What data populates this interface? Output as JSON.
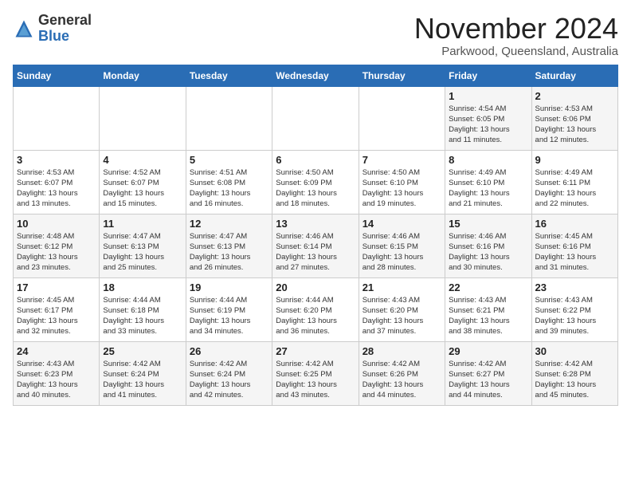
{
  "header": {
    "logo_general": "General",
    "logo_blue": "Blue",
    "month_title": "November 2024",
    "subtitle": "Parkwood, Queensland, Australia"
  },
  "days_of_week": [
    "Sunday",
    "Monday",
    "Tuesday",
    "Wednesday",
    "Thursday",
    "Friday",
    "Saturday"
  ],
  "weeks": [
    [
      {
        "day": "",
        "info": ""
      },
      {
        "day": "",
        "info": ""
      },
      {
        "day": "",
        "info": ""
      },
      {
        "day": "",
        "info": ""
      },
      {
        "day": "",
        "info": ""
      },
      {
        "day": "1",
        "info": "Sunrise: 4:54 AM\nSunset: 6:05 PM\nDaylight: 13 hours\nand 11 minutes."
      },
      {
        "day": "2",
        "info": "Sunrise: 4:53 AM\nSunset: 6:06 PM\nDaylight: 13 hours\nand 12 minutes."
      }
    ],
    [
      {
        "day": "3",
        "info": "Sunrise: 4:53 AM\nSunset: 6:07 PM\nDaylight: 13 hours\nand 13 minutes."
      },
      {
        "day": "4",
        "info": "Sunrise: 4:52 AM\nSunset: 6:07 PM\nDaylight: 13 hours\nand 15 minutes."
      },
      {
        "day": "5",
        "info": "Sunrise: 4:51 AM\nSunset: 6:08 PM\nDaylight: 13 hours\nand 16 minutes."
      },
      {
        "day": "6",
        "info": "Sunrise: 4:50 AM\nSunset: 6:09 PM\nDaylight: 13 hours\nand 18 minutes."
      },
      {
        "day": "7",
        "info": "Sunrise: 4:50 AM\nSunset: 6:10 PM\nDaylight: 13 hours\nand 19 minutes."
      },
      {
        "day": "8",
        "info": "Sunrise: 4:49 AM\nSunset: 6:10 PM\nDaylight: 13 hours\nand 21 minutes."
      },
      {
        "day": "9",
        "info": "Sunrise: 4:49 AM\nSunset: 6:11 PM\nDaylight: 13 hours\nand 22 minutes."
      }
    ],
    [
      {
        "day": "10",
        "info": "Sunrise: 4:48 AM\nSunset: 6:12 PM\nDaylight: 13 hours\nand 23 minutes."
      },
      {
        "day": "11",
        "info": "Sunrise: 4:47 AM\nSunset: 6:13 PM\nDaylight: 13 hours\nand 25 minutes."
      },
      {
        "day": "12",
        "info": "Sunrise: 4:47 AM\nSunset: 6:13 PM\nDaylight: 13 hours\nand 26 minutes."
      },
      {
        "day": "13",
        "info": "Sunrise: 4:46 AM\nSunset: 6:14 PM\nDaylight: 13 hours\nand 27 minutes."
      },
      {
        "day": "14",
        "info": "Sunrise: 4:46 AM\nSunset: 6:15 PM\nDaylight: 13 hours\nand 28 minutes."
      },
      {
        "day": "15",
        "info": "Sunrise: 4:46 AM\nSunset: 6:16 PM\nDaylight: 13 hours\nand 30 minutes."
      },
      {
        "day": "16",
        "info": "Sunrise: 4:45 AM\nSunset: 6:16 PM\nDaylight: 13 hours\nand 31 minutes."
      }
    ],
    [
      {
        "day": "17",
        "info": "Sunrise: 4:45 AM\nSunset: 6:17 PM\nDaylight: 13 hours\nand 32 minutes."
      },
      {
        "day": "18",
        "info": "Sunrise: 4:44 AM\nSunset: 6:18 PM\nDaylight: 13 hours\nand 33 minutes."
      },
      {
        "day": "19",
        "info": "Sunrise: 4:44 AM\nSunset: 6:19 PM\nDaylight: 13 hours\nand 34 minutes."
      },
      {
        "day": "20",
        "info": "Sunrise: 4:44 AM\nSunset: 6:20 PM\nDaylight: 13 hours\nand 36 minutes."
      },
      {
        "day": "21",
        "info": "Sunrise: 4:43 AM\nSunset: 6:20 PM\nDaylight: 13 hours\nand 37 minutes."
      },
      {
        "day": "22",
        "info": "Sunrise: 4:43 AM\nSunset: 6:21 PM\nDaylight: 13 hours\nand 38 minutes."
      },
      {
        "day": "23",
        "info": "Sunrise: 4:43 AM\nSunset: 6:22 PM\nDaylight: 13 hours\nand 39 minutes."
      }
    ],
    [
      {
        "day": "24",
        "info": "Sunrise: 4:43 AM\nSunset: 6:23 PM\nDaylight: 13 hours\nand 40 minutes."
      },
      {
        "day": "25",
        "info": "Sunrise: 4:42 AM\nSunset: 6:24 PM\nDaylight: 13 hours\nand 41 minutes."
      },
      {
        "day": "26",
        "info": "Sunrise: 4:42 AM\nSunset: 6:24 PM\nDaylight: 13 hours\nand 42 minutes."
      },
      {
        "day": "27",
        "info": "Sunrise: 4:42 AM\nSunset: 6:25 PM\nDaylight: 13 hours\nand 43 minutes."
      },
      {
        "day": "28",
        "info": "Sunrise: 4:42 AM\nSunset: 6:26 PM\nDaylight: 13 hours\nand 44 minutes."
      },
      {
        "day": "29",
        "info": "Sunrise: 4:42 AM\nSunset: 6:27 PM\nDaylight: 13 hours\nand 44 minutes."
      },
      {
        "day": "30",
        "info": "Sunrise: 4:42 AM\nSunset: 6:28 PM\nDaylight: 13 hours\nand 45 minutes."
      }
    ]
  ]
}
